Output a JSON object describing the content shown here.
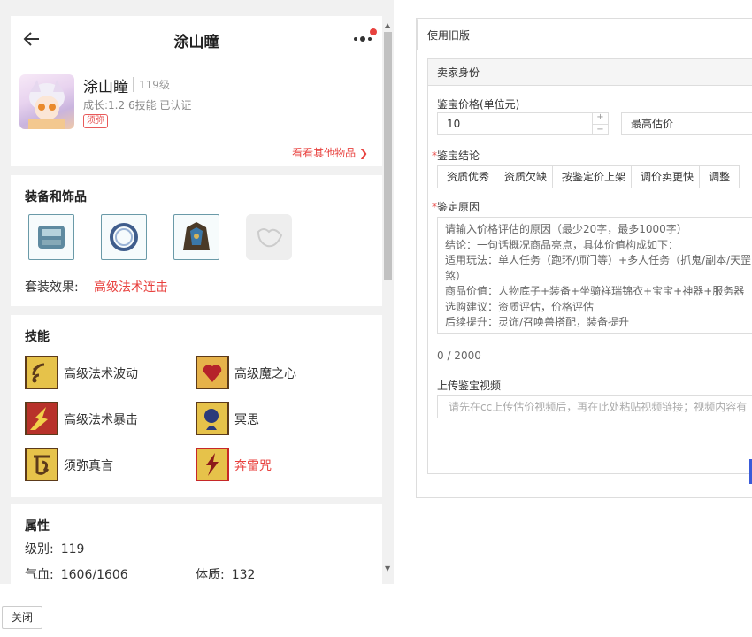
{
  "header": {
    "title": "涂山瞳"
  },
  "profile": {
    "name": "涂山瞳",
    "level": "119级",
    "growth": "成长:1.2 6技能 已认证",
    "tag": "须弥",
    "link": "看看其他物品"
  },
  "equipment": {
    "title": "装备和饰品",
    "set_label": "套装效果:",
    "set_value": "高级法术连击"
  },
  "skills": {
    "title": "技能",
    "items": [
      "高级法术波动",
      "高级魔之心",
      "高级法术暴击",
      "冥思",
      "须弥真言",
      "奔雷咒"
    ],
    "highlight_color": "#e8423f"
  },
  "attributes": {
    "title": "属性",
    "level_label": "级别:",
    "level_value": "119",
    "hp_label": "气血:",
    "hp_value": "1606/1606",
    "con_label": "体质:",
    "con_value": "132"
  },
  "right": {
    "tab": "使用旧版",
    "section_header": "卖家身份",
    "price_label": "鉴宝价格(单位元)",
    "price_value": "10",
    "price_select": "最高估价",
    "conclusion_label": "鉴宝结论",
    "conclusion_buttons": [
      "资质优秀",
      "资质欠缺",
      "按鉴定价上架",
      "调价卖更快",
      "调整"
    ],
    "reason_label": "鉴定原因",
    "reason_lines": [
      "请输入价格评估的原因（最少20字，最多1000字）",
      "  结论：一句话概况商品亮点，具体价值构成如下：",
      "  适用玩法：单人任务（跑环/师门等）+多人任务（抓鬼/副本/天罡",
      "煞）",
      "  商品价值：人物底子+装备+坐骑祥瑞锦衣+宝宝+神器+服务器",
      "  选购建议：资质评估，价格评估",
      "  后续提升：灵饰/召唤兽搭配，装备提升"
    ],
    "count": "0 / 2000",
    "video_label": "上传鉴宝视频",
    "video_placeholder": "请先在cc上传估价视频后，再在此处粘贴视频链接；视频内容有"
  },
  "footer": {
    "close_label": "关闭"
  },
  "colors": {
    "accent_red": "#e8423f",
    "brand_blue": "#3a5bd9"
  }
}
